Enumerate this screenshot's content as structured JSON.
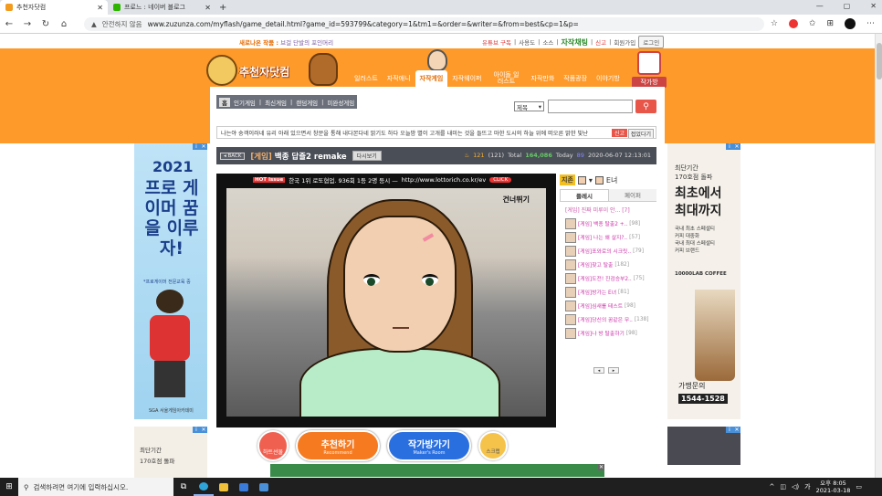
{
  "browser": {
    "tabs": [
      {
        "label": "추천자닷컴",
        "color": "#f29b1e"
      },
      {
        "label": "프로느 : 네이버 블로그",
        "color": "#2db400"
      }
    ],
    "new_tab": "+",
    "insecure_label": "안전하지 않음",
    "url": "www.zuzunza.com/myflash/game_detail.html?game_id=593799&category=1&tm1=&order=&writer=&from=best&cp=1&p="
  },
  "top": {
    "promo_text": "새로나온 작품 :",
    "promo_link": "브걸 단발의 포인머리",
    "links": [
      "유튜브 구독",
      "사용도",
      "소스"
    ],
    "create_link": "자작채팅",
    "links2": [
      "신고",
      "회원가입"
    ],
    "login": "로그인"
  },
  "header": {
    "logo_text": "추천자닷컴",
    "nav": [
      "일러스트",
      "자작애니",
      "자작게임",
      "자작웨이퍼",
      "아이돌 일러스트",
      "자작만화",
      "작품광장",
      "이야기방"
    ],
    "active_nav": "자작게임",
    "artist_room": "작가방"
  },
  "subnav": {
    "home": "홈",
    "items": [
      "인기게임",
      "최신게임",
      "랜덤게임",
      "미완성게임"
    ]
  },
  "search": {
    "select_value": "제목",
    "button_icon": "search-icon"
  },
  "notice": {
    "text": "나는야 숭객이러네 유리 아래 있으면서 창문을 통해 내다본다네 밝기도 하다 오늘밤 별이 고개를 내미는 것을 들뜨고 마한 도시의 하늘 위에 떠오른 밝한 빛난",
    "btn1": "신고",
    "btn2": "접었다기"
  },
  "game": {
    "back": "◂ BACK",
    "category": "[게임]",
    "title": "백종 답즐2 remake",
    "retry": "다시보기",
    "hot_count": "121",
    "hot_paren": "(121)",
    "total_label": "Total",
    "total": "164,086",
    "today_label": "Today",
    "today": "89",
    "date": "2020-06-07 12:13:01",
    "ad_hot": "HOT Issue",
    "ad_text": "한국 1위 로또협업. 936회 1등 2명 등시 —",
    "ad_url": "http://www.lottorich.co.kr/ev",
    "ad_click": "CLICK",
    "scene_label": "건너뛰기"
  },
  "sidebar": {
    "jichon": "지존",
    "user_tag": "E녀",
    "tab_on": "플레시",
    "tab_off": "페이퍼",
    "first": "[게임] 진짜 미루이 안...",
    "first_cnt": "[7]",
    "items": [
      {
        "title": "[게임] 백종 탈출2 +..",
        "cnt": "[98]"
      },
      {
        "title": "[게임] 나는 왜 살지?..",
        "cnt": "[57]"
      },
      {
        "title": "[게임]포와로의 시크릿..",
        "cnt": "[79]"
      },
      {
        "title": "[게임]찾고 탈출",
        "cnt": "[182]"
      },
      {
        "title": "[게임]도전! 진검승부2..",
        "cnt": "[75]"
      },
      {
        "title": "[게임]방가는 E녀",
        "cnt": "[81]"
      },
      {
        "title": "[게임]심새를 테스트",
        "cnt": "[98]"
      },
      {
        "title": "[게임]당신의 꿈같은 무..",
        "cnt": "[138]"
      },
      {
        "title": "[게임]나 방 탈출하기",
        "cnt": "[98]"
      }
    ],
    "prev": "◂",
    "next": "▸"
  },
  "buttons": {
    "heart": "하트선물",
    "recommend": "추천하기",
    "recommend_sub": "Recommend",
    "artist": "작가방가기",
    "artist_sub": "Maker's Room",
    "scrap": "스크랩"
  },
  "ads": {
    "left_year": "2021",
    "left_big": "프로 게이머 꿈을 이루자!",
    "left_small": "*프로게이머 전문교육 중",
    "left_logo": "SGA 서울게임아카데미",
    "left2_t1": "최단기간",
    "left2_t2": "170호점 돌파",
    "right_t1": "최단기간\n170호점 돌파",
    "right_t2": "최초에서\n최대까지",
    "right_t3": "국내 최초 스페셜티\n커피 대중화\n국내 최대 스페셜티\n커피 브랜드",
    "right_brand": "10000LAB COFFEE",
    "right_price": "가맹문의",
    "right_phone": "1544-1528"
  },
  "taskbar": {
    "search_placeholder": "검색하려면 여기에 입력하십시오.",
    "time": "오후 8:05",
    "date": "2021-03-18"
  }
}
